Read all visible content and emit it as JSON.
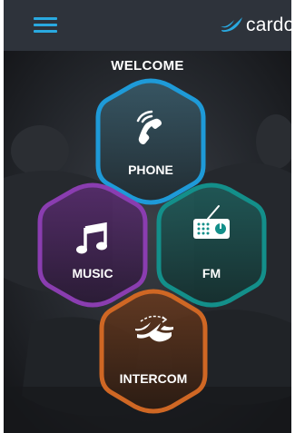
{
  "app": {
    "logo_text": "cardo",
    "welcome": "WELCOME"
  },
  "tiles": {
    "phone": {
      "label": "PHONE",
      "icon": "phone-icon",
      "color": "#1e9ad8"
    },
    "music": {
      "label": "MUSIC",
      "icon": "music-note-icon",
      "color": "#8a3db0"
    },
    "fm": {
      "label": "FM",
      "icon": "radio-icon",
      "color": "#138f8a"
    },
    "intercom": {
      "label": "INTERCOM",
      "icon": "intercom-icon",
      "color": "#cf6724"
    }
  },
  "colors": {
    "accent": "#29a9e0",
    "topbar": "#2e333b"
  }
}
